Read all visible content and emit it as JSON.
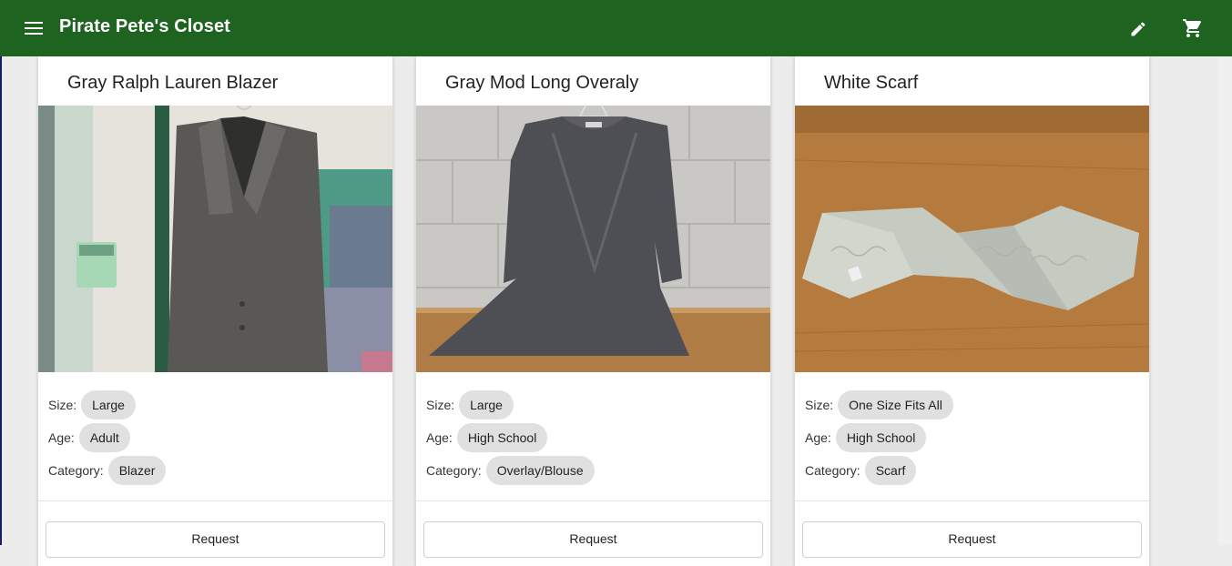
{
  "app": {
    "title": "Pirate Pete's Closet",
    "menu_icon": "menu-icon",
    "edit_icon": "pencil-icon",
    "cart_icon": "cart-icon",
    "brand_color": "#1e6320"
  },
  "cards": [
    {
      "title": "Gray Ralph Lauren Blazer",
      "size_label": "Size:",
      "size": "Large",
      "age_label": "Age:",
      "age": "Adult",
      "category_label": "Category:",
      "category": "Blazer",
      "request_label": "Request"
    },
    {
      "title": "Gray Mod Long Overaly",
      "size_label": "Size:",
      "size": "Large",
      "age_label": "Age:",
      "age": "High School",
      "category_label": "Category:",
      "category": "Overlay/Blouse",
      "request_label": "Request"
    },
    {
      "title": "White Scarf",
      "size_label": "Size:",
      "size": "One Size Fits All",
      "age_label": "Age:",
      "age": "High School",
      "category_label": "Category:",
      "category": "Scarf",
      "request_label": "Request"
    }
  ],
  "chip_color": "#e0e0e0"
}
